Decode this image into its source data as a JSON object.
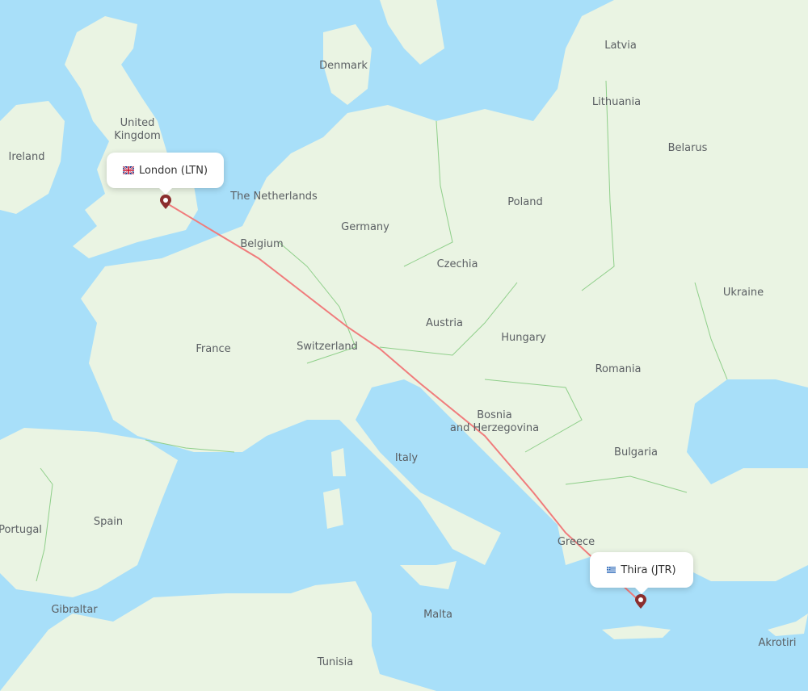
{
  "map": {
    "colors": {
      "water": "#a8dff9",
      "land": "#eaf4e3",
      "border": "#8fcf8a",
      "route": "#f07c7c",
      "marker": "#8b2e2e"
    },
    "countries": [
      {
        "name": "United Kingdom",
        "label": "United\nKingdom"
      },
      {
        "name": "Ireland",
        "label": "Ireland"
      },
      {
        "name": "Denmark",
        "label": "Denmark"
      },
      {
        "name": "Latvia",
        "label": "Latvia"
      },
      {
        "name": "Lithuania",
        "label": "Lithuania"
      },
      {
        "name": "Belarus",
        "label": "Belarus"
      },
      {
        "name": "The Netherlands",
        "label": "The Netherlands"
      },
      {
        "name": "Germany",
        "label": "Germany"
      },
      {
        "name": "Poland",
        "label": "Poland"
      },
      {
        "name": "Belgium",
        "label": "Belgium"
      },
      {
        "name": "Czechia",
        "label": "Czechia"
      },
      {
        "name": "Ukraine",
        "label": "Ukraine"
      },
      {
        "name": "Austria",
        "label": "Austria"
      },
      {
        "name": "France",
        "label": "France"
      },
      {
        "name": "Switzerland",
        "label": "Switzerland"
      },
      {
        "name": "Hungary",
        "label": "Hungary"
      },
      {
        "name": "Romania",
        "label": "Romania"
      },
      {
        "name": "Bosnia and Herzegovina",
        "label": "Bosnia\nand Herzegovina"
      },
      {
        "name": "Italy",
        "label": "Italy"
      },
      {
        "name": "Bulgaria",
        "label": "Bulgaria"
      },
      {
        "name": "Spain",
        "label": "Spain"
      },
      {
        "name": "Portugal",
        "label": "Portugal"
      },
      {
        "name": "Greece",
        "label": "Greece"
      },
      {
        "name": "Gibraltar",
        "label": "Gibraltar"
      },
      {
        "name": "Malta",
        "label": "Malta"
      },
      {
        "name": "Tunisia",
        "label": "Tunisia"
      },
      {
        "name": "Akrotiri",
        "label": "Akrotiri"
      }
    ],
    "origin": {
      "city": "London",
      "code": "LTN",
      "label": "London (LTN)",
      "flag": "uk-flag"
    },
    "destination": {
      "city": "Thira",
      "code": "JTR",
      "label": "Thira (JTR)",
      "flag": "greece-flag"
    }
  }
}
